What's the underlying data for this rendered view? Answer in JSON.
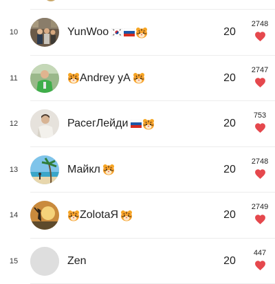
{
  "leaderboard": {
    "rows": [
      {
        "rank": "10",
        "name": "YunWoo",
        "score": "20",
        "likes": "2748",
        "avatar": "photo-people-indoor",
        "badges_after": [
          "flag-kr",
          "flag-ru",
          "tiger-emoji"
        ],
        "badges_before": []
      },
      {
        "rank": "11",
        "name": "Andrey yA",
        "score": "20",
        "likes": "2747",
        "avatar": "photo-man-green",
        "badges_before": [
          "tiger-emoji"
        ],
        "badges_after": [
          "tiger-emoji"
        ]
      },
      {
        "rank": "12",
        "name": "РасегЛейди",
        "score": "20",
        "likes": "753",
        "avatar": "photo-person-sweater",
        "badges_before": [],
        "badges_after": [
          "flag-ru",
          "tiger-emoji"
        ]
      },
      {
        "rank": "13",
        "name": "Майкл",
        "score": "20",
        "likes": "2748",
        "avatar": "photo-beach-palm",
        "badges_before": [],
        "badges_after": [
          "tiger-emoji"
        ]
      },
      {
        "rank": "14",
        "name": "ZolotaЯ",
        "score": "20",
        "likes": "2749",
        "avatar": "photo-sunset-silhouette",
        "badges_before": [
          "tiger-emoji"
        ],
        "badges_after": [
          "tiger-emoji"
        ]
      },
      {
        "rank": "15",
        "name": "Zen",
        "score": "20",
        "likes": "447",
        "avatar": "blank-gray",
        "badges_before": [],
        "badges_after": []
      }
    ]
  },
  "colors": {
    "heart": "#e5484d",
    "divider": "#ececec",
    "text": "#202020"
  }
}
